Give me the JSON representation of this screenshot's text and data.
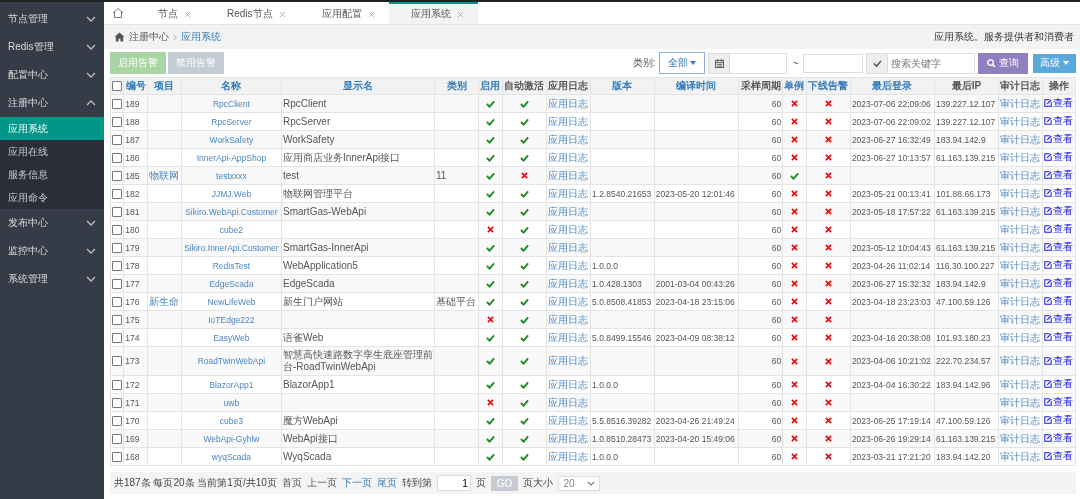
{
  "sidebar": {
    "items": [
      {
        "label": "节点管理",
        "expanded": false
      },
      {
        "label": "Redis管理",
        "expanded": false
      },
      {
        "label": "配置中心",
        "expanded": false
      },
      {
        "label": "注册中心",
        "expanded": true,
        "children": [
          {
            "label": "应用系统",
            "selected": true
          },
          {
            "label": "应用在线",
            "selected": false
          },
          {
            "label": "服务信息",
            "selected": false
          },
          {
            "label": "应用命令",
            "selected": false
          }
        ]
      },
      {
        "label": "发布中心",
        "expanded": false
      },
      {
        "label": "监控中心",
        "expanded": false
      },
      {
        "label": "系统管理",
        "expanded": false
      }
    ]
  },
  "tabs": [
    {
      "label": "节点",
      "selected": false
    },
    {
      "label": "Redis节点",
      "selected": false
    },
    {
      "label": "应用配置",
      "selected": false
    },
    {
      "label": "应用系统",
      "selected": true
    }
  ],
  "breadcrumb": {
    "items": [
      "注册中心",
      "应用系统"
    ],
    "description": "应用系统。服务提供者和消费者"
  },
  "toolbar": {
    "buttons": [
      {
        "label": "启用告警",
        "kind": "success"
      },
      {
        "label": "禁用告警",
        "kind": "default"
      }
    ],
    "category_label": "类别:",
    "category": "全部",
    "range_separator": "~",
    "search_placeholder": "搜索关键字",
    "search_button": "查询",
    "advanced_button": "高级"
  },
  "table": {
    "select_all": {
      "checked": false
    },
    "columns": [
      "编号",
      "项目",
      "名称",
      "显示名",
      "类别",
      "启用",
      "自动激活",
      "应用日志",
      "版本",
      "编译时间",
      "采样周期",
      "单例",
      "下线告警",
      "最后登录",
      "最后IP",
      "审计日志",
      "操作"
    ],
    "rows": [
      {
        "checked": false,
        "id": "189",
        "name": "RpcClient",
        "display": "RpcClient",
        "enabled": true,
        "auto": true,
        "log": "应用日志",
        "period": "60",
        "singleton": false,
        "offline_alert": false,
        "last_login": "2023-07-06 22:09:06",
        "last_ip": "139.227.12.107",
        "audit": "审计日志",
        "action": "查看"
      },
      {
        "checked": false,
        "id": "188",
        "name": "RpcServer",
        "display": "RpcServer",
        "enabled": true,
        "auto": true,
        "log": "应用日志",
        "period": "60",
        "singleton": false,
        "offline_alert": false,
        "last_login": "2023-07-06 22:09:02",
        "last_ip": "139.227.12.107",
        "audit": "审计日志",
        "action": "查看"
      },
      {
        "checked": false,
        "id": "187",
        "name": "WorkSafety",
        "display": "WorkSafety",
        "enabled": true,
        "auto": true,
        "log": "应用日志",
        "period": "60",
        "singleton": false,
        "offline_alert": false,
        "last_login": "2023-06-27 16:32:49",
        "last_ip": "183.94.142.9",
        "audit": "审计日志",
        "action": "查看"
      },
      {
        "checked": false,
        "id": "186",
        "name": "InnerApi-AppShop",
        "display": "应用商店业务InnerApi接口",
        "enabled": true,
        "auto": true,
        "log": "应用日志",
        "period": "60",
        "singleton": false,
        "offline_alert": false,
        "last_login": "2023-06-27 10:13:57",
        "last_ip": "61.163.139.215",
        "audit": "审计日志",
        "action": "查看"
      },
      {
        "checked": false,
        "id": "185",
        "project": "物联网",
        "name": "testxxxx",
        "display": "test",
        "category": "11",
        "enabled": true,
        "auto": false,
        "log": "应用日志",
        "period": "60",
        "singleton": true,
        "offline_alert": false,
        "audit": "审计日志",
        "action": "查看"
      },
      {
        "checked": false,
        "id": "182",
        "name": "JJMJ.Web",
        "display": "物联网管理平台",
        "enabled": true,
        "auto": true,
        "log": "应用日志",
        "version": "1.2.8540.21653",
        "compile_time": "2023-05-20 12:01:46",
        "period": "60",
        "singleton": false,
        "offline_alert": false,
        "last_login": "2023-05-21 00:13:41",
        "last_ip": "101.88.66.173",
        "audit": "审计日志",
        "action": "查看"
      },
      {
        "checked": false,
        "id": "181",
        "name": "Sikiro.WebApi.Customer",
        "display": "SmartGas-WebApi",
        "enabled": true,
        "auto": true,
        "log": "应用日志",
        "period": "60",
        "singleton": false,
        "offline_alert": false,
        "last_login": "2023-05-18 17:57:22",
        "last_ip": "61.163.139.215",
        "audit": "审计日志",
        "action": "查看"
      },
      {
        "checked": false,
        "id": "180",
        "name": "cube2",
        "enabled": false,
        "auto": true,
        "log": "应用日志",
        "period": "60",
        "singleton": false,
        "offline_alert": false,
        "audit": "审计日志",
        "action": "查看"
      },
      {
        "checked": false,
        "id": "179",
        "name": "Sikiro.InnerApi.Customer",
        "display": "SmartGas-InnerApi",
        "enabled": true,
        "auto": true,
        "log": "应用日志",
        "period": "60",
        "singleton": false,
        "offline_alert": false,
        "last_login": "2023-05-12 10:04:43",
        "last_ip": "61.163.139.215",
        "audit": "审计日志",
        "action": "查看"
      },
      {
        "checked": false,
        "id": "178",
        "name": "RedisTest",
        "display": "WebApplication5",
        "enabled": true,
        "auto": true,
        "log": "应用日志",
        "version": "1.0.0.0",
        "period": "60",
        "singleton": false,
        "offline_alert": false,
        "last_login": "2023-04-26 11:02:14",
        "last_ip": "116.30.100.227",
        "audit": "审计日志",
        "action": "查看"
      },
      {
        "checked": false,
        "id": "177",
        "name": "EdgeScada",
        "display": "EdgeScada",
        "enabled": true,
        "auto": true,
        "log": "应用日志",
        "version": "1.0.428.1303",
        "compile_time": "2001-03-04 00:43:26",
        "period": "60",
        "singleton": false,
        "offline_alert": false,
        "last_login": "2023-06-27 15:32:32",
        "last_ip": "183.94.142.9",
        "audit": "审计日志",
        "action": "查看"
      },
      {
        "checked": false,
        "id": "176",
        "project": "新生命",
        "name": "NewLifeWeb",
        "display": "新生门户网站",
        "category": "基础平台",
        "enabled": true,
        "auto": true,
        "log": "应用日志",
        "version": "5.0.8508.41853",
        "compile_time": "2023-04-18 23:15:06",
        "period": "60",
        "singleton": false,
        "offline_alert": false,
        "last_login": "2023-04-18 23:23:03",
        "last_ip": "47.100.59.126",
        "audit": "审计日志",
        "action": "查看"
      },
      {
        "checked": false,
        "id": "175",
        "name": "IoTEdge222",
        "enabled": false,
        "auto": true,
        "log": "应用日志",
        "period": "60",
        "singleton": false,
        "offline_alert": false,
        "audit": "审计日志",
        "action": "查看"
      },
      {
        "checked": false,
        "id": "174",
        "name": "EasyWeb",
        "display": "语雀Web",
        "enabled": true,
        "auto": true,
        "log": "应用日志",
        "version": "5.0.8499.15546",
        "compile_time": "2023-04-09 08:38:12",
        "period": "60",
        "singleton": false,
        "offline_alert": false,
        "last_login": "2023-04-16 20:38:08",
        "last_ip": "101.93.180.23",
        "audit": "审计日志",
        "action": "查看"
      },
      {
        "checked": false,
        "id": "173",
        "name": "RoadTwinWebApi",
        "display": "智慧高快速路数字孪生底座管理前台-RoadTwinWebApi",
        "enabled": true,
        "auto": true,
        "log": "应用日志",
        "period": "60",
        "singleton": false,
        "offline_alert": false,
        "last_login": "2023-04-06 10:21:02",
        "last_ip": "222.70.234.57",
        "audit": "审计日志",
        "action": "查看"
      },
      {
        "checked": false,
        "id": "172",
        "name": "BlazorApp1",
        "display": "BlazorApp1",
        "enabled": true,
        "auto": true,
        "log": "应用日志",
        "version": "1.0.0.0",
        "period": "60",
        "singleton": false,
        "offline_alert": false,
        "last_login": "2023-04-04 16:30:22",
        "last_ip": "183.94.142.96",
        "audit": "审计日志",
        "action": "查看"
      },
      {
        "checked": false,
        "id": "171",
        "name": "uwb",
        "enabled": false,
        "auto": true,
        "log": "应用日志",
        "period": "60",
        "singleton": false,
        "offline_alert": false,
        "audit": "审计日志",
        "action": "查看"
      },
      {
        "checked": false,
        "id": "170",
        "name": "cube3",
        "display": "魔方WebApi",
        "enabled": true,
        "auto": true,
        "log": "应用日志",
        "version": "5.5.8516.39282",
        "compile_time": "2023-04-26 21:49:24",
        "period": "60",
        "singleton": false,
        "offline_alert": false,
        "last_login": "2023-06-25 17:19:14",
        "last_ip": "47.100.59.126",
        "audit": "审计日志",
        "action": "查看"
      },
      {
        "checked": false,
        "id": "169",
        "name": "WebApi-Gyhlw",
        "display": "WebApi接口",
        "enabled": true,
        "auto": true,
        "log": "应用日志",
        "version": "1.0.8510.28473",
        "compile_time": "2023-04-20 15:49:06",
        "period": "60",
        "singleton": false,
        "offline_alert": false,
        "last_login": "2023-06-26 19:29:14",
        "last_ip": "61.163.139.215",
        "audit": "审计日志",
        "action": "查看"
      },
      {
        "checked": false,
        "id": "168",
        "name": "wyqScada",
        "display": "WyqScada",
        "enabled": true,
        "auto": true,
        "log": "应用日志",
        "version": "1.0.0.0",
        "period": "60",
        "singleton": false,
        "offline_alert": false,
        "last_login": "2023-03-21 17:21:20",
        "last_ip": "183.94.142.20",
        "audit": "审计日志",
        "action": "查看"
      }
    ]
  },
  "pagination": {
    "summary": "共187条 每页20条 当前第1页/共10页",
    "links": [
      {
        "label": "首页",
        "disabled": true
      },
      {
        "label": "上一页",
        "disabled": true
      },
      {
        "label": "下一页",
        "disabled": false
      },
      {
        "label": "尾页",
        "disabled": false
      }
    ],
    "goto_label": "转到第",
    "page_value": "1",
    "page_unit": "页",
    "go_button": "GO",
    "size_label": "页大小",
    "page_size": "20"
  }
}
